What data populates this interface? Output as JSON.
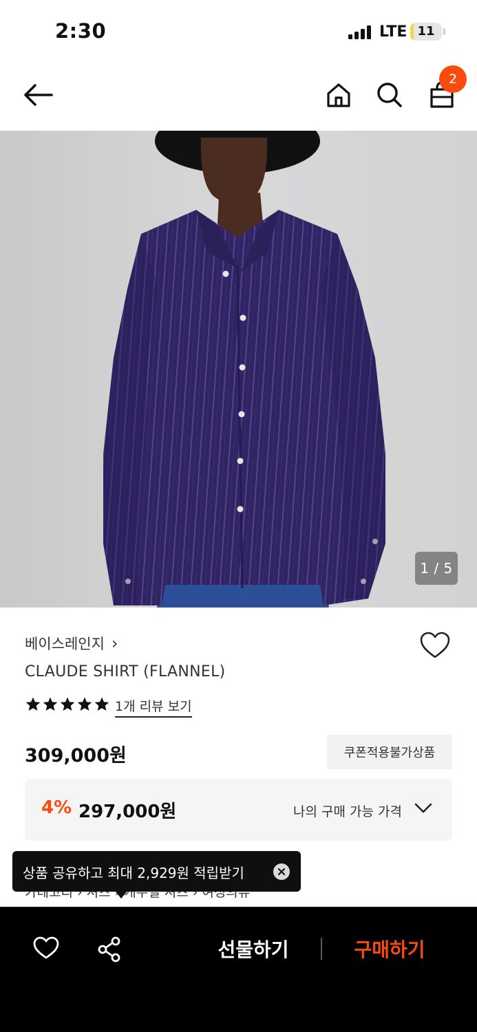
{
  "status_bar": {
    "time": "2:30",
    "network": "LTE",
    "battery": "11",
    "battery_level_percent": 11
  },
  "nav": {
    "back_icon": "arrow-left-icon",
    "home_icon": "home-icon",
    "search_icon": "search-icon",
    "cart_icon": "shopping-bag-icon",
    "cart_badge": "2"
  },
  "gallery": {
    "counter": "1 / 5"
  },
  "product": {
    "brand": "베이스레인지",
    "brand_chevron": "›",
    "name": "CLAUDE SHIRT (FLANNEL)",
    "rating_stars": 5,
    "review_link": "1개 리뷰 보기",
    "price": "309,000원",
    "coupon_tag": "쿠폰적용불가상품",
    "discount_rate": "4%",
    "discount_price": "297,000원",
    "my_price_label": "나의 구매 가능 가격"
  },
  "breadcrumb": "카테고리 › 셔츠 › 캐주얼 셔츠 › 여성의류",
  "tooltip": {
    "text": "상품 공유하고 최대 2,929원 적립받기"
  },
  "bottom_bar": {
    "gift_label": "선물하기",
    "buy_label": "구매하기"
  },
  "colors": {
    "accent": "#fa4b0f",
    "bottom_bar_bg": "#000000",
    "shirt": "#2e2460",
    "background_wall": "#d4d4d5"
  }
}
